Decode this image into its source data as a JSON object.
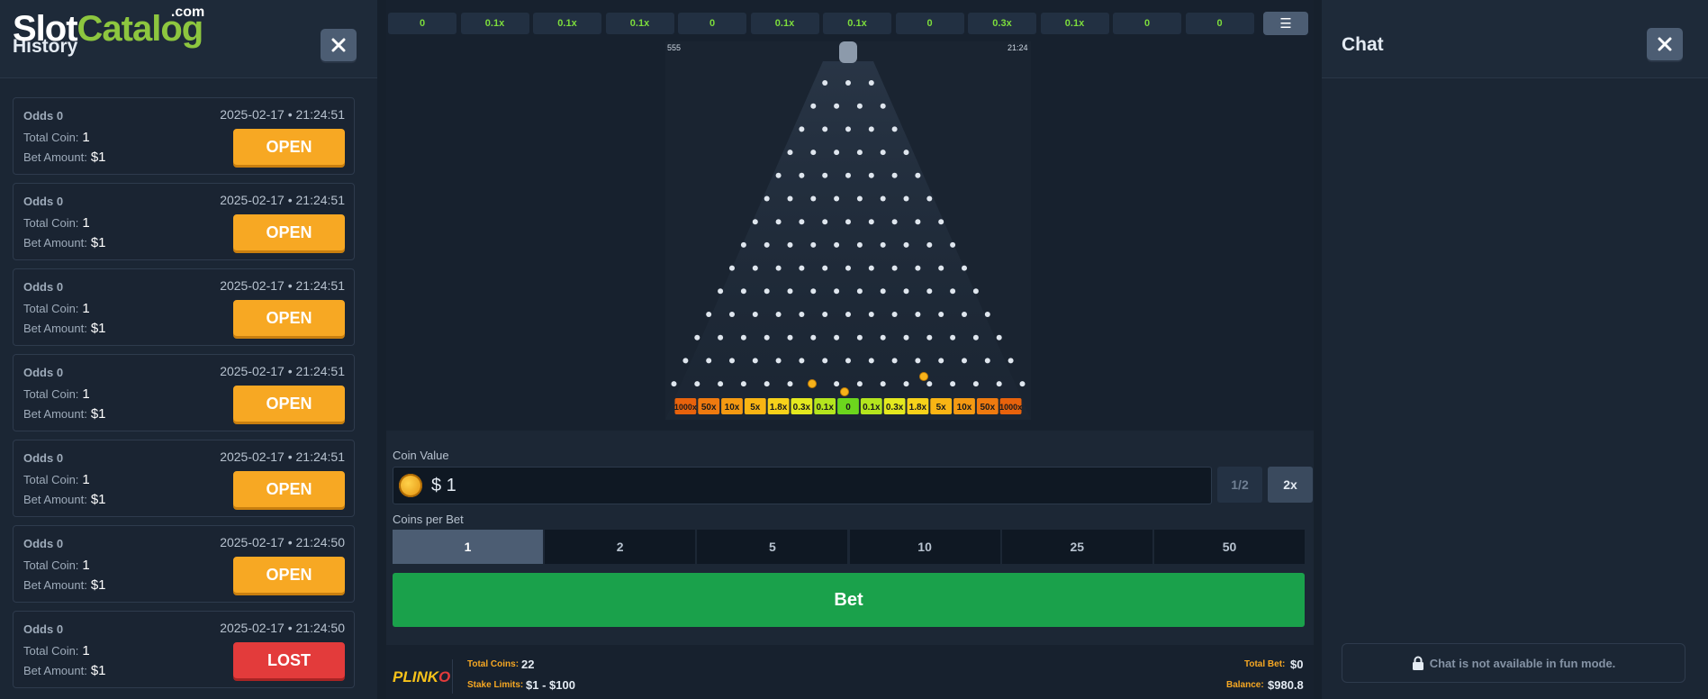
{
  "logo": {
    "part1": "Slot",
    "part2": "Catalog",
    "suffix": ".com"
  },
  "history": {
    "title": "History",
    "odds_label": "Odds",
    "total_coin_label": "Total Coin:",
    "bet_amount_label": "Bet Amount:",
    "entries": [
      {
        "odds": "0",
        "date": "2025-02-17 • 21:24:51",
        "total_coin": "1",
        "bet_amount": "$1",
        "action": "OPEN"
      },
      {
        "odds": "0",
        "date": "2025-02-17 • 21:24:51",
        "total_coin": "1",
        "bet_amount": "$1",
        "action": "OPEN"
      },
      {
        "odds": "0",
        "date": "2025-02-17 • 21:24:51",
        "total_coin": "1",
        "bet_amount": "$1",
        "action": "OPEN"
      },
      {
        "odds": "0",
        "date": "2025-02-17 • 21:24:51",
        "total_coin": "1",
        "bet_amount": "$1",
        "action": "OPEN"
      },
      {
        "odds": "0",
        "date": "2025-02-17 • 21:24:51",
        "total_coin": "1",
        "bet_amount": "$1",
        "action": "OPEN"
      },
      {
        "odds": "0",
        "date": "2025-02-17 • 21:24:50",
        "total_coin": "1",
        "bet_amount": "$1",
        "action": "OPEN"
      },
      {
        "odds": "0",
        "date": "2025-02-17 • 21:24:50",
        "total_coin": "1",
        "bet_amount": "$1",
        "action": "LOST"
      }
    ]
  },
  "top_multipliers": [
    "0",
    "0.1x",
    "0.1x",
    "0.1x",
    "0",
    "0.1x",
    "0.1x",
    "0",
    "0.3x",
    "0.1x",
    "0",
    "0"
  ],
  "board": {
    "stat_left": "555",
    "stat_right": "21:24",
    "rows": 15,
    "slots": [
      {
        "label": "1000x",
        "color": "#e8620c"
      },
      {
        "label": "50x",
        "color": "#ef7a0f"
      },
      {
        "label": "10x",
        "color": "#f59a12"
      },
      {
        "label": "5x",
        "color": "#f9b514"
      },
      {
        "label": "1.8x",
        "color": "#f7d21a"
      },
      {
        "label": "0.3x",
        "color": "#e4e91f"
      },
      {
        "label": "0.1x",
        "color": "#b4e51e"
      },
      {
        "label": "0",
        "color": "#6cd61d"
      },
      {
        "label": "0.1x",
        "color": "#b4e51e"
      },
      {
        "label": "0.3x",
        "color": "#e4e91f"
      },
      {
        "label": "1.8x",
        "color": "#f7d21a"
      },
      {
        "label": "5x",
        "color": "#f9b514"
      },
      {
        "label": "10x",
        "color": "#f59a12"
      },
      {
        "label": "50x",
        "color": "#ef7a0f"
      },
      {
        "label": "1000x",
        "color": "#e8620c"
      }
    ]
  },
  "bet_panel": {
    "coin_value_label": "Coin Value",
    "coin_value": "$ 1",
    "half_label": "1/2",
    "double_label": "2x",
    "coins_per_bet_label": "Coins per Bet",
    "coins_per_bet_options": [
      "1",
      "2",
      "5",
      "10",
      "25",
      "50"
    ],
    "bet_label": "Bet"
  },
  "footer": {
    "game_logo_a": "PLINK",
    "game_logo_b": "O",
    "total_coins_label": "Total Coins:",
    "total_coins": "22",
    "stake_limits_label": "Stake Limits:",
    "stake_limits": "$1 - $100",
    "total_bet_label": "Total Bet:",
    "total_bet": "$0",
    "balance_label": "Balance:",
    "balance": "$980.8"
  },
  "chat": {
    "title": "Chat",
    "notice": "Chat is not available in fun mode."
  },
  "colors": {
    "open": "#f7a823",
    "lost": "#e33b3b",
    "bet": "#1aa14b",
    "accent_green": "#7cdc3c"
  }
}
